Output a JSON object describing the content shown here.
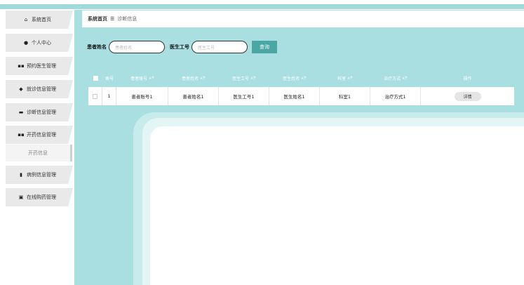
{
  "sidebar": {
    "items": [
      {
        "label": "系统首页",
        "icon": "home-icon",
        "glyph": "⌂"
      },
      {
        "label": "个人中心",
        "icon": "user-icon",
        "glyph": "●"
      },
      {
        "label": "预约医生管理",
        "icon": "grid-icon",
        "glyph": "▪▪"
      },
      {
        "label": "就诊信息管理",
        "icon": "pin-icon",
        "glyph": "◆"
      },
      {
        "label": "诊断信息管理",
        "icon": "bed-icon",
        "glyph": "▬"
      },
      {
        "label": "开药信息管理",
        "icon": "grid-icon",
        "glyph": "▪▪"
      },
      {
        "label": "病例信息管理",
        "icon": "doc-icon",
        "glyph": "▮"
      },
      {
        "label": "在线购药管理",
        "icon": "clipboard-icon",
        "glyph": "▣"
      }
    ],
    "sub_item": "开药信息"
  },
  "breadcrumb": {
    "home": "系统首页",
    "separator": "☰",
    "current": "诊断信息"
  },
  "search": {
    "patient_name_label": "患者姓名",
    "patient_name_placeholder": "患者姓名",
    "doctor_id_label": "医生工号",
    "doctor_id_placeholder": "医生工号",
    "query_button": "查询"
  },
  "table": {
    "headers": [
      "索号",
      "患者账号",
      "患者姓名",
      "医生工号",
      "医生姓名",
      "科室",
      "治疗方式",
      "操作"
    ],
    "rows": [
      {
        "index": "1",
        "account": "患者账号1",
        "name": "患者姓名1",
        "doctor_id": "医生工号1",
        "doctor_name": "医生姓名1",
        "dept": "科室1",
        "treatment": "治疗方式1",
        "action": "详情"
      }
    ]
  }
}
